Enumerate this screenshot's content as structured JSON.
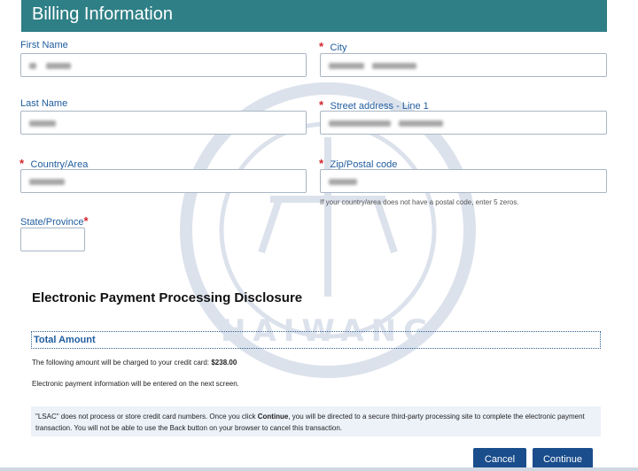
{
  "header": {
    "title": "Billing Information"
  },
  "form": {
    "first_name": {
      "label": "First Name",
      "value": ""
    },
    "city": {
      "label": "City",
      "value": "",
      "required": "*"
    },
    "last_name": {
      "label": "Last Name",
      "value": ""
    },
    "street": {
      "label": "Street address - Line 1",
      "value": "",
      "required": "*"
    },
    "country": {
      "label": "Country/Area",
      "value": "",
      "required": "*"
    },
    "zip": {
      "label": "Zip/Postal code",
      "value": "",
      "required": "*",
      "hint": "If your country/area does not have a postal code, enter 5 zeros."
    },
    "state": {
      "label": "State/Province",
      "required": "*",
      "value": ""
    }
  },
  "disclosure": {
    "title": "Electronic Payment Processing Disclosure",
    "total_title": "Total Amount",
    "charge_text": "The following amount will be charged to your credit card:",
    "amount": "$238.00",
    "next_screen_text": "Electronic payment information will be entered on the next screen.",
    "notice_part1": "\"LSAC\" does not process or store credit card numbers. Once you click ",
    "notice_bold": "Continue",
    "notice_part2": ", you will be directed to a secure third-party processing site to complete the electronic payment transaction. You will not be able to use the Back button on your browser to cancel this transaction."
  },
  "buttons": {
    "cancel": "Cancel",
    "continue": "Continue"
  },
  "watermark": {
    "text": "HAIWANG"
  },
  "colors": {
    "header": "#2f7f86",
    "label": "#1f5c9e",
    "required": "#d3242b",
    "button": "#1a4d8c"
  }
}
